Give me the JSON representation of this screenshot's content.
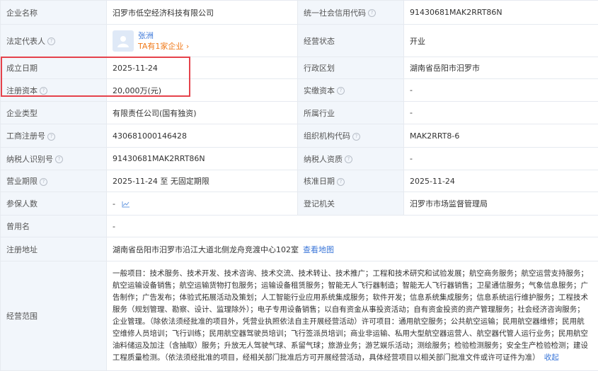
{
  "rows": {
    "name_label": "企业名称",
    "name_value": "汨罗市低空经济科技有限公司",
    "credit_label": "统一社会信用代码",
    "credit_value": "91430681MAK2RRT86N",
    "legal_label": "法定代表人",
    "legal_name": "张洲",
    "legal_tag": "TA有1家企业 ›",
    "status_label": "经营状态",
    "status_value": "开业",
    "est_label": "成立日期",
    "est_value": "2025-11-24",
    "region_label": "行政区划",
    "region_value": "湖南省岳阳市汨罗市",
    "capital_label": "注册资本",
    "capital_value": "20,000万(元)",
    "paid_label": "实缴资本",
    "paid_value": "-",
    "type_label": "企业类型",
    "type_value": "有限责任公司(国有独资)",
    "industry_label": "所属行业",
    "industry_value": "-",
    "reg_no_label": "工商注册号",
    "reg_no_value": "430681000146428",
    "org_code_label": "组织机构代码",
    "org_code_value": "MAK2RRT8-6",
    "tax_id_label": "纳税人识别号",
    "tax_id_value": "91430681MAK2RRT86N",
    "tax_qual_label": "纳税人资质",
    "tax_qual_value": "-",
    "term_label": "营业期限",
    "term_value": "2025-11-24 至 无固定期限",
    "approve_label": "核准日期",
    "approve_value": "2025-11-24",
    "insured_label": "参保人数",
    "insured_value": "-",
    "authority_label": "登记机关",
    "authority_value": "汨罗市市场监督管理局",
    "former_label": "曾用名",
    "former_value": "-",
    "address_label": "注册地址",
    "address_value": "湖南省岳阳市汨罗市沿江大道北侧龙舟竞渡中心102室",
    "map_link": "查看地图",
    "scope_label": "经营范围",
    "scope_value": "一般项目：技术服务、技术开发、技术咨询、技术交流、技术转让、技术推广；工程和技术研究和试验发展；航空商务服务；航空运营支持服务；航空运输设备销售；航空运输货物打包服务；运输设备租赁服务；智能无人飞行器制造；智能无人飞行器销售；卫星通信服务；气象信息服务；广告制作；广告发布；体验式拓展活动及策划；人工智能行业应用系统集成服务；软件开发；信息系统集成服务；信息系统运行维护服务；工程技术服务（规划管理、勘察、设计、监理除外）；电子专用设备销售；以自有资金从事投资活动；自有资金投资的资产管理服务；社会经济咨询服务；企业管理。（除依法须经批准的项目外，凭营业执照依法自主开展经营活动）许可项目：通用航空服务；公共航空运输；民用航空器维修；民用航空维修人员培训；飞行训练；民用航空器驾驶员培训；飞行签派员培训；商业非运输、私用大型航空器运营人、航空器代管人运行业务；民用航空油料储运及加注（含抽取）服务；升放无人驾驶气球、系留气球；旅游业务；游艺娱乐活动；测绘服务；检验检测服务；安全生产检验检测；建设工程质量检测。（依法须经批准的项目，经相关部门批准后方可开展经营活动，具体经营项目以相关部门批准文件或许可证件为准）",
    "collapse_link": "收起"
  }
}
